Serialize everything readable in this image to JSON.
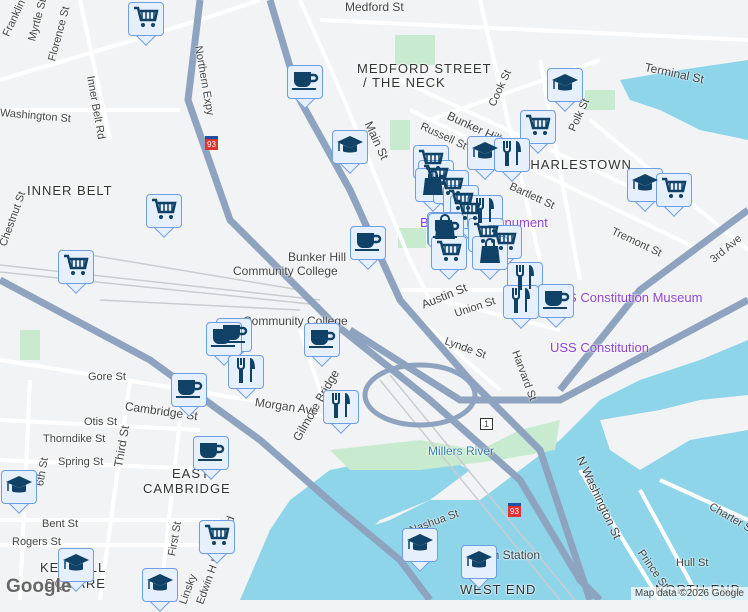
{
  "map": {
    "area_labels": [
      "MEDFORD STREET",
      "/ THE NECK",
      "INNER BELT",
      "CHARLESTOWN",
      "EAST",
      "CAMBRIDGE",
      "KENDALL",
      "SQUARE",
      "WEST END",
      "NORTH END"
    ],
    "street_labels": [
      "Medford St",
      "Terminal St",
      "Main St",
      "Bunker Hill St",
      "Russell St",
      "Cook St",
      "Polk St",
      "Bartlett St",
      "Tremont St",
      "3rd Ave",
      "Austin St",
      "Union St",
      "Lynde St",
      "Harvard St",
      "Gore St",
      "Cambridge St",
      "Otis St",
      "Thorndike St",
      "Spring St",
      "Third St",
      "Gilmore Bridge",
      "Morgan Ave",
      "Bent St",
      "Rogers St",
      "First St",
      "Edwin H Land Blvd",
      "Nashua St",
      "N Washington St",
      "Charter St",
      "Prince St",
      "Hull St",
      "Washington St",
      "Inner Belt Rd",
      "Northern Expy",
      "Florence St",
      "Myrtle St",
      "Franklin",
      "Linsky",
      "6th St",
      "Chestnut St"
    ],
    "poi_labels": [
      "Bunker Hill",
      "Community College",
      "Community College",
      "Bunker Hill Monument",
      "USS Constitution Museum",
      "USS Constitution",
      "Millers River",
      "North Station"
    ],
    "route_shields": [
      "93",
      "1"
    ],
    "attribution": "Map data ©2026 Google",
    "logo": "Google",
    "colors": {
      "water": "#8fd5ea",
      "park": "#c8ebcf",
      "highway": "#8ea3bf",
      "marker_bg": "#e6effc",
      "marker_border": "#6d9de2",
      "marker_icon": "#0f4266",
      "poi": "#8e44d9"
    }
  }
}
